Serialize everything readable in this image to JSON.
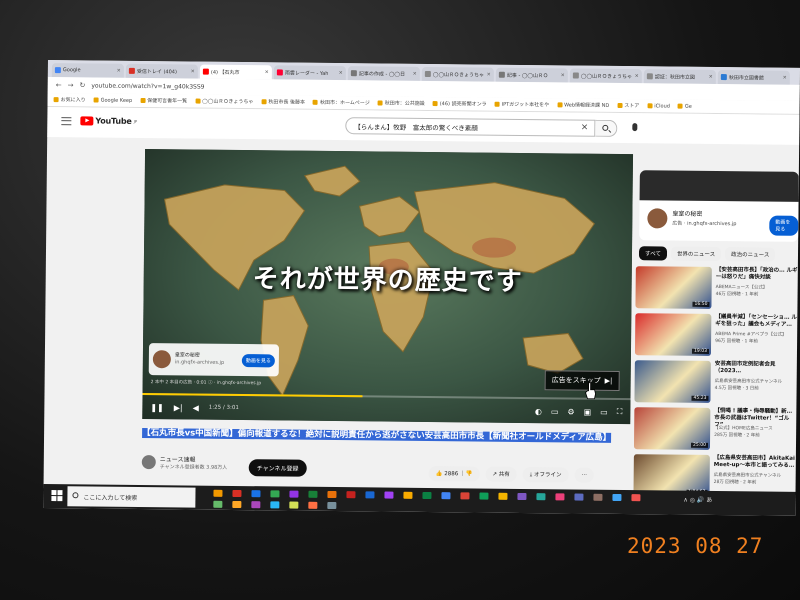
{
  "browser": {
    "tabs": [
      {
        "label": "Google",
        "color": "#4285f4",
        "active": false
      },
      {
        "label": "受信トレイ (404)",
        "color": "#d93025",
        "active": false
      },
      {
        "label": "(4) 【石丸市",
        "color": "#ff0000",
        "active": true
      },
      {
        "label": "雨雲レーダー - Yah",
        "color": "#ff0033",
        "active": false
      },
      {
        "label": "記事の作成 - ◯◯日",
        "color": "#777777",
        "active": false
      },
      {
        "label": "◯◯山ＲＯきょうちゃ",
        "color": "#888888",
        "active": false
      },
      {
        "label": "記事 - ◯◯山ＲＯ",
        "color": "#777777",
        "active": false
      },
      {
        "label": "◯◯山ＲＯきょうちゃ",
        "color": "#888888",
        "active": false
      },
      {
        "label": "認証：秋田市立図",
        "color": "#888888",
        "active": false
      },
      {
        "label": "秋田市立図書館",
        "color": "#2a7ad3",
        "active": false
      }
    ],
    "url": "youtube.com/watch?v=1w_g40k3SS9",
    "bookmarks": [
      "お気に入り",
      "Google Keep",
      "保健可言書年一覧",
      "◯◯山ＲＯきょうちゃ",
      "秋田市長 後藤本",
      "秋田市：ホームページ",
      "秋田市：公共施設",
      "(46) 読売新聞オンラ",
      "IPTガジット本社をや",
      "Web情報経済課 ND",
      "ストア",
      "iCloud",
      "Ge"
    ]
  },
  "youtube": {
    "logo": "YouTube",
    "logo_region": "JP",
    "search_query": "【らんまん】牧野　富太郎の驚くべき素顔"
  },
  "player": {
    "caption": "それが世界の歴史です",
    "ad_card": {
      "name": "皇室の秘密",
      "domain": "in.ghqfx-archives.jp",
      "button": "動画を見る"
    },
    "ad_info": "2 本中 2 本目の広告 · 0:01 ⓘ · in.ghqfx-archives.jp",
    "skip_label": "広告をスキップ",
    "time": "1:25 / 3:01",
    "progress": 0.45
  },
  "video": {
    "title": "【石丸市長vs中国新聞】偏向報道するな！絶対に説明責任から逃がさない安芸高田市市長【新聞社オールドメディア広島】",
    "channel_name": "ニュース速報",
    "channel_subs": "チャンネル登録者数 3.98万人",
    "subscribe_label": "チャンネル登録",
    "likes": "2886",
    "share": "共有",
    "offline": "オフライン",
    "more": "…"
  },
  "sidebar": {
    "sponsor": {
      "name": "皇室の秘密",
      "sub": "広告 · in.ghqfx-archives.jp",
      "button": "動画を見る"
    },
    "chips": [
      "すべて",
      "世界のニュース",
      "政治のニュース"
    ],
    "recommendations": [
      {
        "title": "【安芸高田市長】「政治の… ルギーは怒りだ」痛快対談",
        "channel": "ABEMAニュース【公式】",
        "meta": "46万 回視聴 · 1 年前",
        "duration": "16:50",
        "thumb": "#c43a2a"
      },
      {
        "title": "【議員半減】「センセーショ… ルギを狙った」議会もメディア…",
        "channel": "ABEMA Prime #アベプラ【公式】",
        "meta": "96万 回視聴 · 1 年前",
        "duration": "19:03",
        "thumb": "#d92b2b"
      },
      {
        "title": "安芸高田市定例記者会見（2023…",
        "channel": "広島県安芸高田市公式チャンネル",
        "meta": "4.5万 回視聴 · 3 日前",
        "duration": "45:23",
        "thumb": "#3a5a8c"
      },
      {
        "title": "【恫喝 ! 議事・侮辱騒動】新… 市長の武器はTwitter！“ゴルフ”",
        "channel": "【公式】HOME広島ニュース",
        "meta": "285万 回視聴 · 2 年前",
        "duration": "25:00",
        "thumb": "#b8443a"
      },
      {
        "title": "【広島県安芸高田市】AkitaKai Meet-up～本市と語ってみる…",
        "channel": "広島県安芸高田市公式チャンネル",
        "meta": "28万 回視聴 · 2 年前",
        "duration": "1:04:57",
        "thumb": "#6c4a2f"
      }
    ]
  },
  "taskbar": {
    "search_placeholder": "ここに入力して検索",
    "tray": "∧ ◎ 🔊 あ"
  },
  "photo_date_stamp": "2023 08 27"
}
